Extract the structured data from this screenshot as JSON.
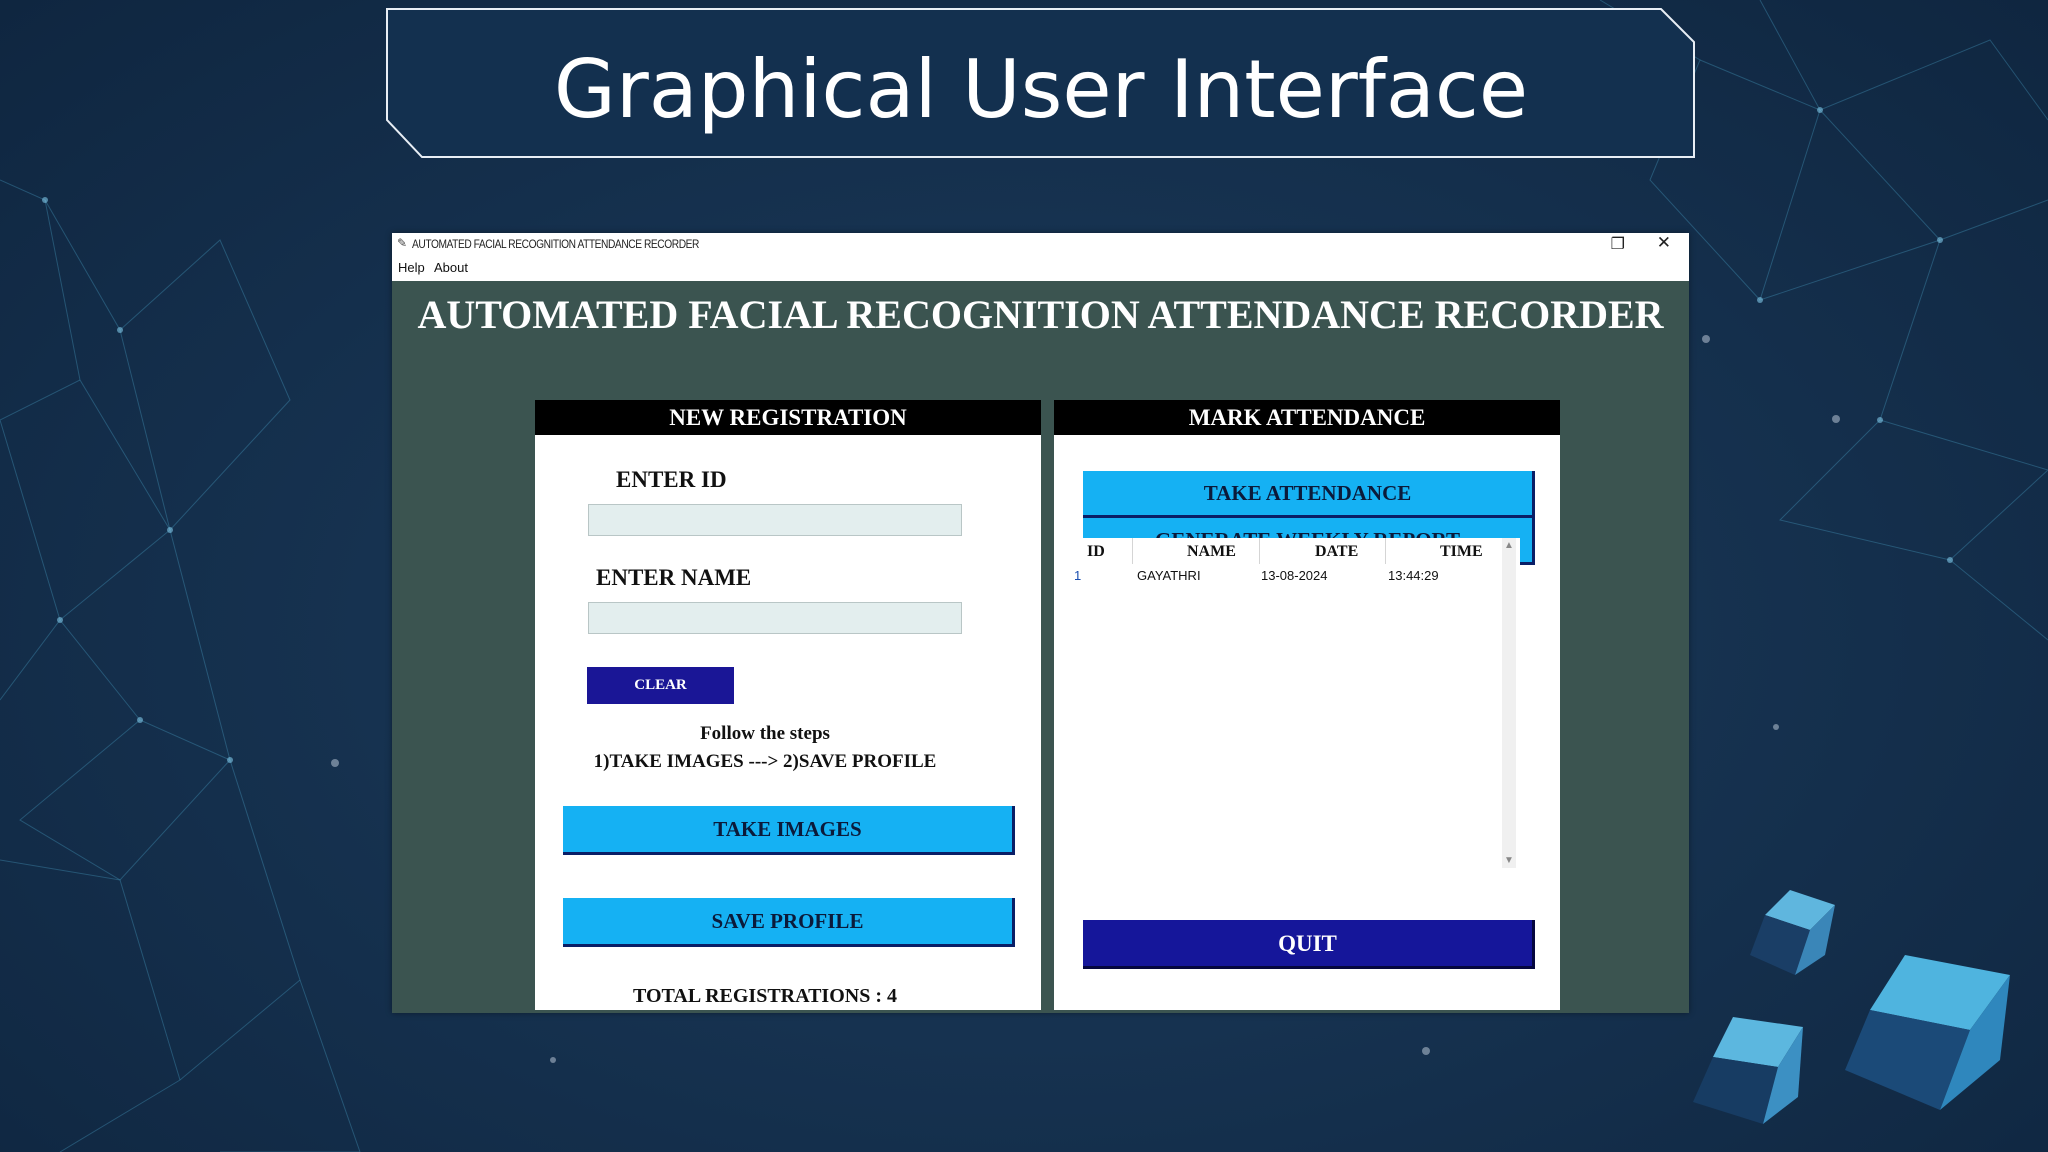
{
  "slide": {
    "title": "Graphical User Interface"
  },
  "window": {
    "title": "AUTOMATED FACIAL RECOGNITION ATTENDANCE RECORDER",
    "restore_glyph": "❐",
    "close_glyph": "✕",
    "menu": [
      "Help",
      "About"
    ]
  },
  "app": {
    "heading": "AUTOMATED FACIAL RECOGNITION ATTENDANCE RECORDER",
    "registration": {
      "title": "NEW REGISTRATION",
      "id_label": "ENTER ID",
      "id_value": "",
      "name_label": "ENTER NAME",
      "name_value": "",
      "clear_label": "CLEAR",
      "steps_line1": "Follow the steps",
      "steps_line2": "1)TAKE IMAGES  ---> 2)SAVE PROFILE",
      "take_images_label": "TAKE IMAGES",
      "save_profile_label": "SAVE PROFILE",
      "total_label": "TOTAL REGISTRATIONS : 4"
    },
    "attendance": {
      "title": "MARK ATTENDANCE",
      "take_attendance_label": "TAKE ATTENDANCE",
      "weekly_report_label": "GENERATE WEEKLY REPORT",
      "columns": [
        "ID",
        "NAME",
        "DATE",
        "TIME"
      ],
      "rows": [
        {
          "id": "1",
          "name": "GAYATHRI",
          "date": "13-08-2024",
          "time": "13:44:29"
        }
      ],
      "quit_label": "QUIT"
    }
  },
  "colors": {
    "window_bg": "#3b5450",
    "cyan_button": "#15b1f3",
    "dark_button": "#15169a",
    "slide_bg": "#163250"
  }
}
